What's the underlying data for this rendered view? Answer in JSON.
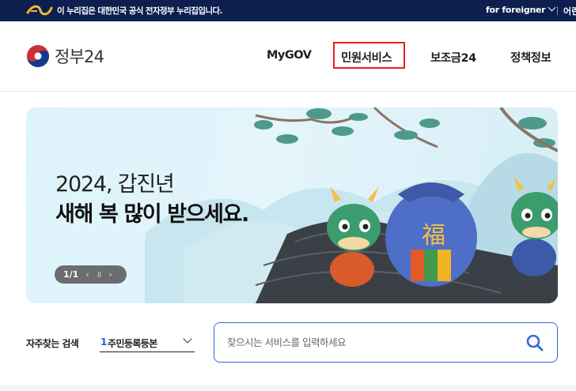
{
  "topbar": {
    "notice": "이 누리집은 대한민국 공식 전자정부 누리집입니다.",
    "foreigner_label": "for foreigner",
    "extra_label": "어린"
  },
  "header": {
    "brand_name": "정부24",
    "nav": [
      {
        "label": "MyGOV"
      },
      {
        "label": "민원서비스"
      },
      {
        "label": "보조금24"
      },
      {
        "label": "정책정보"
      }
    ],
    "highlight_color": "#e81e25"
  },
  "banner": {
    "subtitle": "2024, 갑진년",
    "title": "새해 복 많이 받으세요.",
    "pager": {
      "current": "1/1",
      "prev": "‹",
      "pause": "॥",
      "next": "›"
    },
    "bag_character": "福"
  },
  "search": {
    "frequent_label": "자주찾는 검색",
    "frequent_selected_num": "1",
    "frequent_selected_text": "주민등록등본",
    "placeholder": "찾으시는 서비스를 입력하세요"
  },
  "colors": {
    "topbar_bg": "#0c1f4f",
    "accent_blue": "#2f6bd8",
    "number_blue": "#1e62d0"
  },
  "icons": {
    "gov_mark": "e-government-logo-icon",
    "emblem": "taegeuk-emblem-icon",
    "search": "search-icon",
    "dropdown": "chevron-down-icon"
  }
}
